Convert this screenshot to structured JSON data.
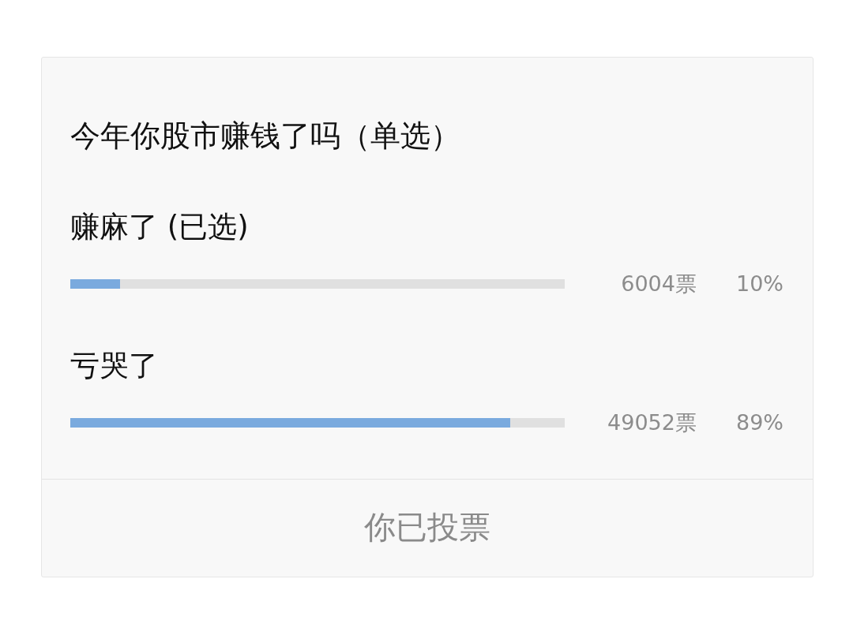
{
  "poll": {
    "question": "今年你股市赚钱了吗（单选）",
    "options": [
      {
        "label": "赚麻了 (已选)",
        "level": 0.1,
        "votes": "6004票",
        "percent": "10%"
      },
      {
        "label": "亏哭了",
        "level": 0.89,
        "votes": "49052票",
        "percent": "89%"
      }
    ],
    "vote_button": {
      "label": "你已投票",
      "disabled": true
    }
  }
}
